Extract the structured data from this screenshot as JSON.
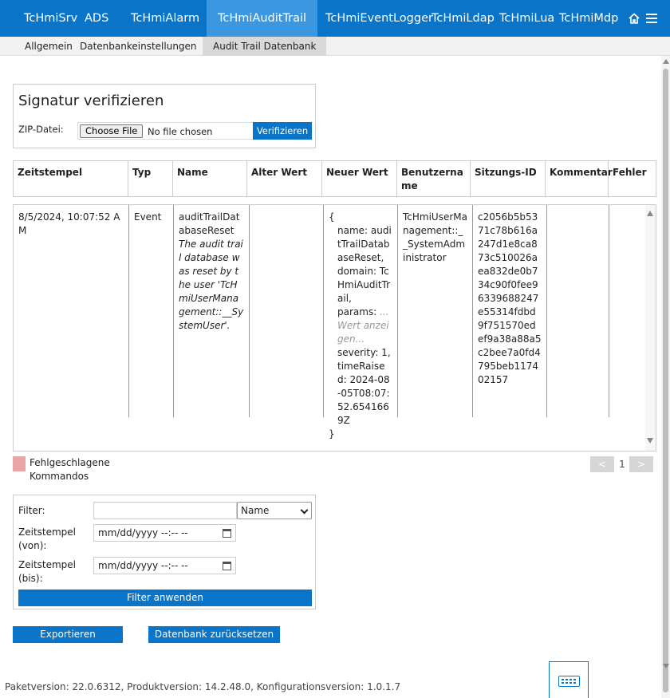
{
  "topnav": {
    "tabs": [
      {
        "label": "TcHmiSrv"
      },
      {
        "label": "ADS"
      },
      {
        "label": "TcHmiAlarm"
      },
      {
        "label": "TcHmiAuditTrail",
        "active": true
      },
      {
        "label": "TcHmiEventLogger"
      },
      {
        "label": "TcHmiLdap"
      },
      {
        "label": "TcHmiLua"
      },
      {
        "label": "TcHmiMdp"
      }
    ],
    "icons": {
      "home": "home-icon",
      "menu": "hamburger-menu-icon"
    }
  },
  "subnav": {
    "tabs": [
      {
        "label": "Allgemein"
      },
      {
        "label": "Datenbankeinstellungen"
      },
      {
        "label": "Audit Trail Datenbank",
        "active": true
      }
    ]
  },
  "signature": {
    "title": "Signatur verifizieren",
    "zip_label": "ZIP-Datei:",
    "choose_label": "Choose File",
    "no_file": "No file chosen",
    "verify_label": "Verifizieren"
  },
  "table": {
    "headers": [
      "Zeitstempel",
      "Typ",
      "Name",
      "Alter Wert",
      "Neuer Wert",
      "Benutzername",
      "Sitzungs-ID",
      "Kommentar",
      "Fehler"
    ],
    "rows": [
      {
        "timestamp": "8/5/2024, 10:07:52 AM",
        "type": "Event",
        "name": "auditTrailDatabaseReset",
        "description": "The audit trail database was reset by the user 'TcHmiUserManagement::__SystemUser'.",
        "old_value": "",
        "new_value": {
          "open": "{",
          "name_line": "name: auditTrailDatabaseReset,",
          "domain_line": "domain: TcHmiAuditTrail,",
          "params_key": "params:",
          "params_hint": "...Wert anzeigen...",
          "severity_line": "severity: 1,",
          "timeraised_line": "timeRaised: 2024-08-05T08:07:52.6541669Z",
          "close": "}"
        },
        "username": "TcHmiUserManagement::__SystemAdministrator",
        "session_id": "c2056b5b5371c78b616a247d1e8ca873c510026aea832de0b734c90f0fee96339688247e55314fdbd9f751570edef9a38a88a5c2bee7a0fd4795beb117402157",
        "comment": "",
        "error": ""
      }
    ]
  },
  "legend": {
    "label": "Fehlgeschlagene Kommandos",
    "color": "#e8a6a6"
  },
  "pager": {
    "prev": "<",
    "page": "1",
    "next": ">"
  },
  "filter": {
    "filter_label": "Filter:",
    "filter_value": "",
    "field_selected": "Name",
    "from_label": "Zeitstempel (von):",
    "from_placeholder": "mm/dd/yyyy --:-- --",
    "to_label": "Zeitstempel (bis):",
    "to_placeholder": "mm/dd/yyyy --:-- --",
    "apply_label": "Filter anwenden"
  },
  "actions": {
    "export_label": "Exportieren",
    "reset_label": "Datenbank zurücksetzen"
  },
  "footer": {
    "text": "Paketversion: 22.0.6312, Produktversion: 14.2.48.0, Konfigurationsversion: 1.0.1.7"
  },
  "colors": {
    "accent": "#0a74c9",
    "accent_active": "#3b97e0"
  }
}
